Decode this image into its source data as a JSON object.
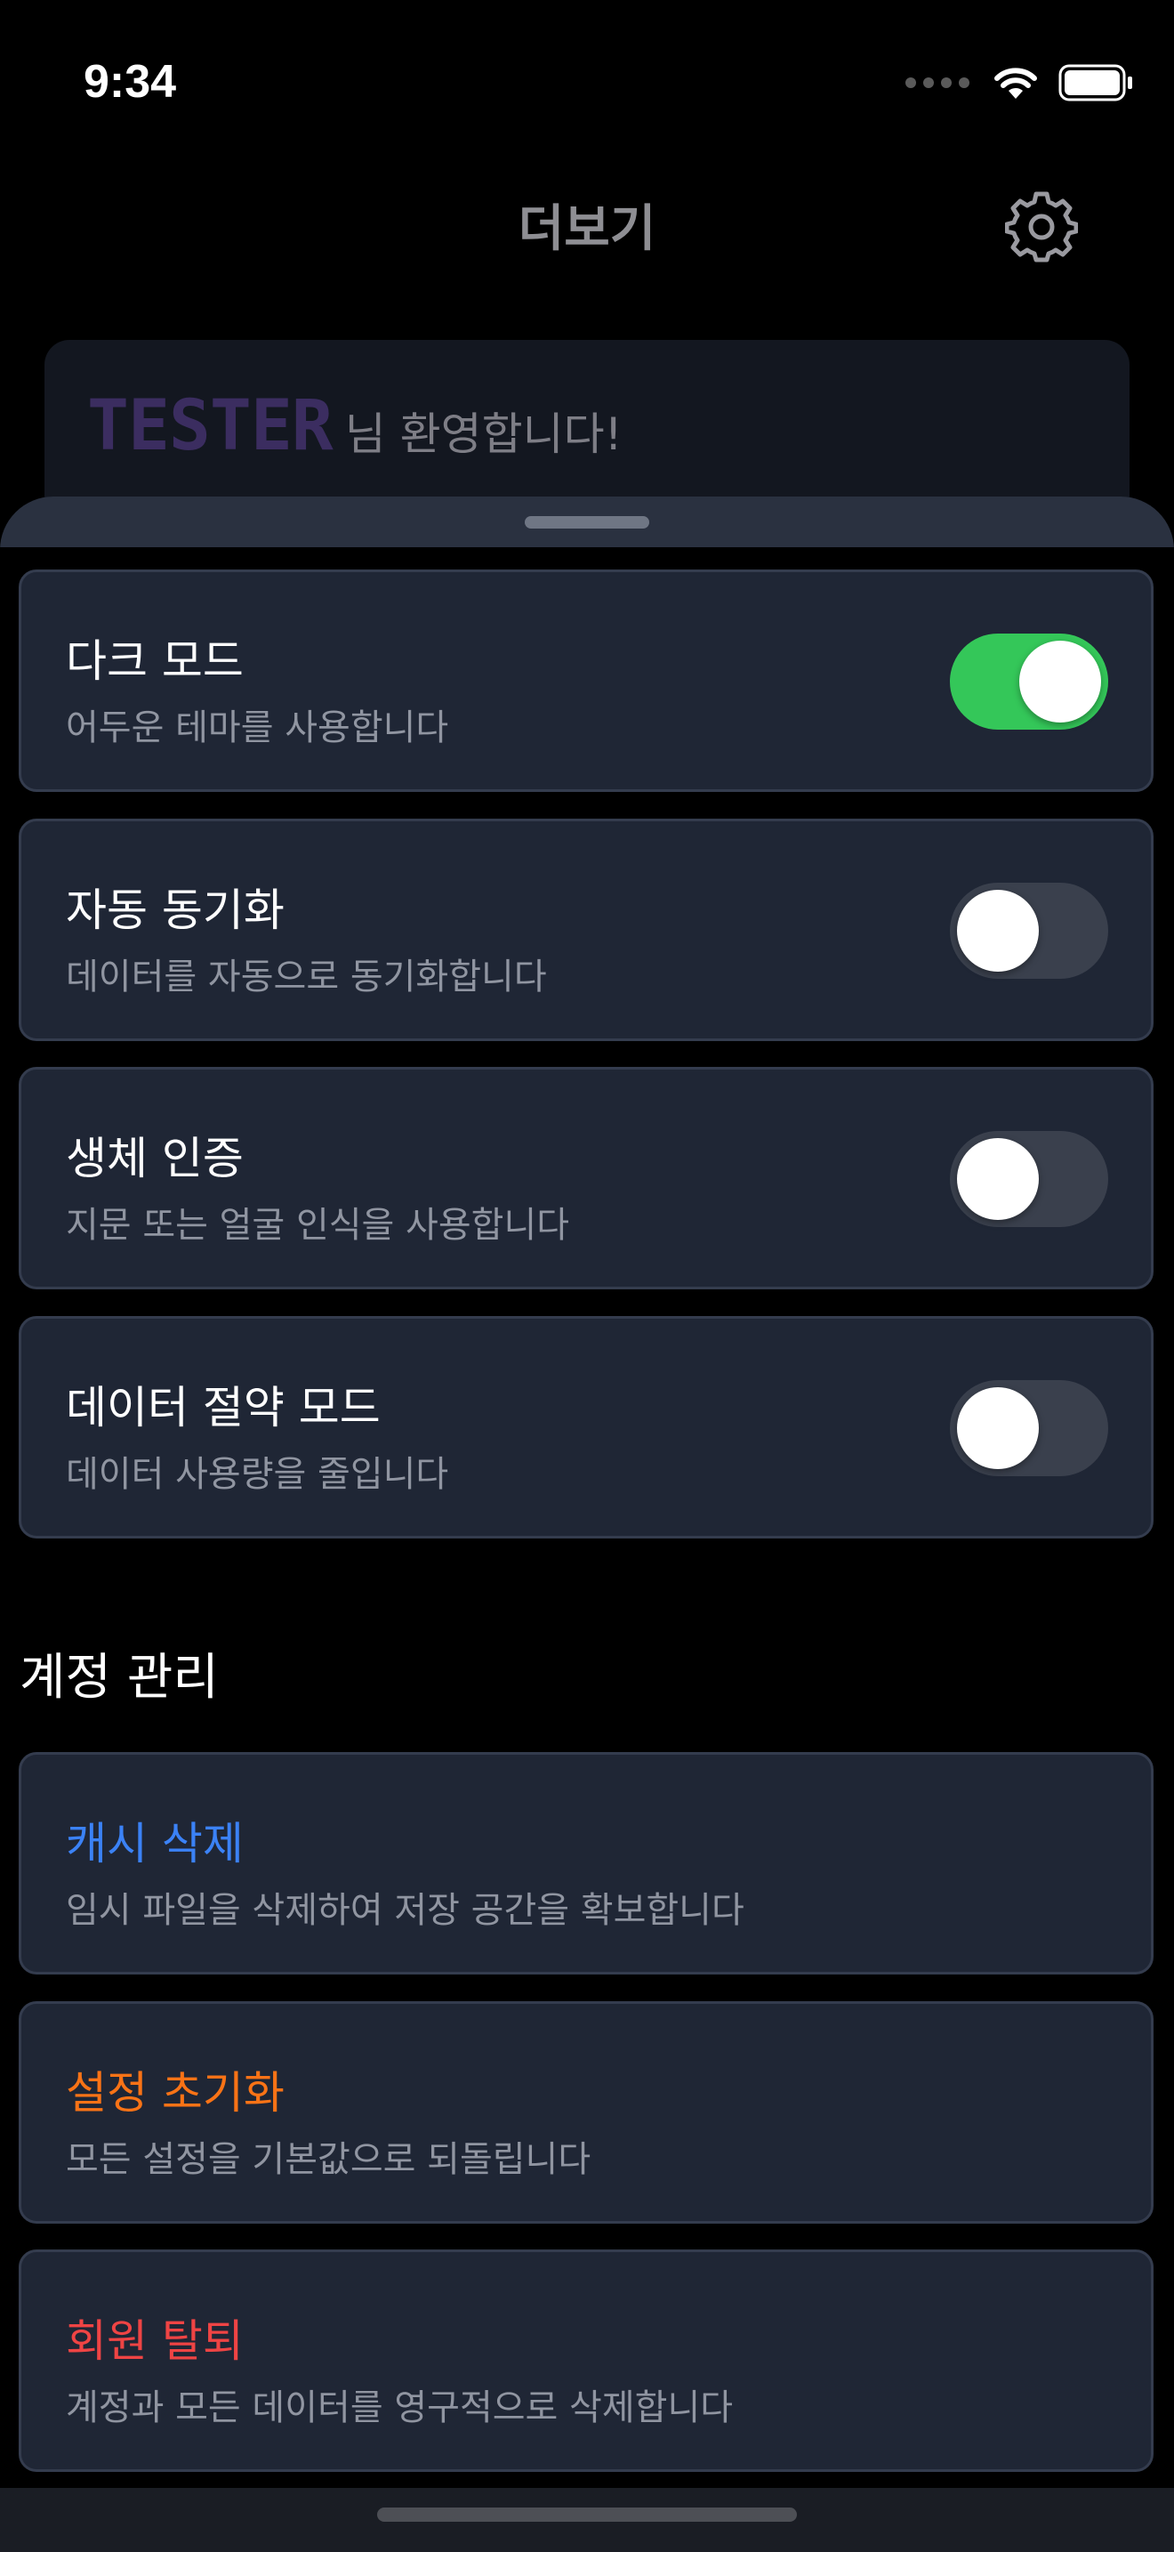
{
  "status_bar": {
    "time": "9:34"
  },
  "header": {
    "title": "더보기"
  },
  "welcome": {
    "name": "TESTER",
    "suffix": "님 환영합니다!"
  },
  "settings": [
    {
      "title": "다크 모드",
      "description": "어두운 테마를 사용합니다",
      "enabled": true
    },
    {
      "title": "자동 동기화",
      "description": "데이터를 자동으로 동기화합니다",
      "enabled": false
    },
    {
      "title": "생체 인증",
      "description": "지문 또는 얼굴 인식을 사용합니다",
      "enabled": false
    },
    {
      "title": "데이터 절약 모드",
      "description": "데이터 사용량을 줄입니다",
      "enabled": false
    }
  ],
  "account_section": {
    "title": "계정 관리",
    "actions": [
      {
        "title": "캐시 삭제",
        "description": "임시 파일을 삭제하여 저장 공간을 확보합니다",
        "color": "#3b82f6"
      },
      {
        "title": "설정 초기화",
        "description": "모든 설정을 기본값으로 되돌립니다",
        "color": "#f97316"
      },
      {
        "title": "회원 탈퇴",
        "description": "계정과 모든 데이터를 영구적으로 삭제합니다",
        "color": "#ef4444"
      }
    ]
  },
  "icons": {
    "signal": "cellular-signal-icon",
    "wifi": "wifi-icon",
    "battery": "battery-icon",
    "settings": "gear-icon"
  },
  "colors": {
    "toggle_on": "#34c759",
    "toggle_off": "#3a404d",
    "card_bg": "#1f2635"
  }
}
